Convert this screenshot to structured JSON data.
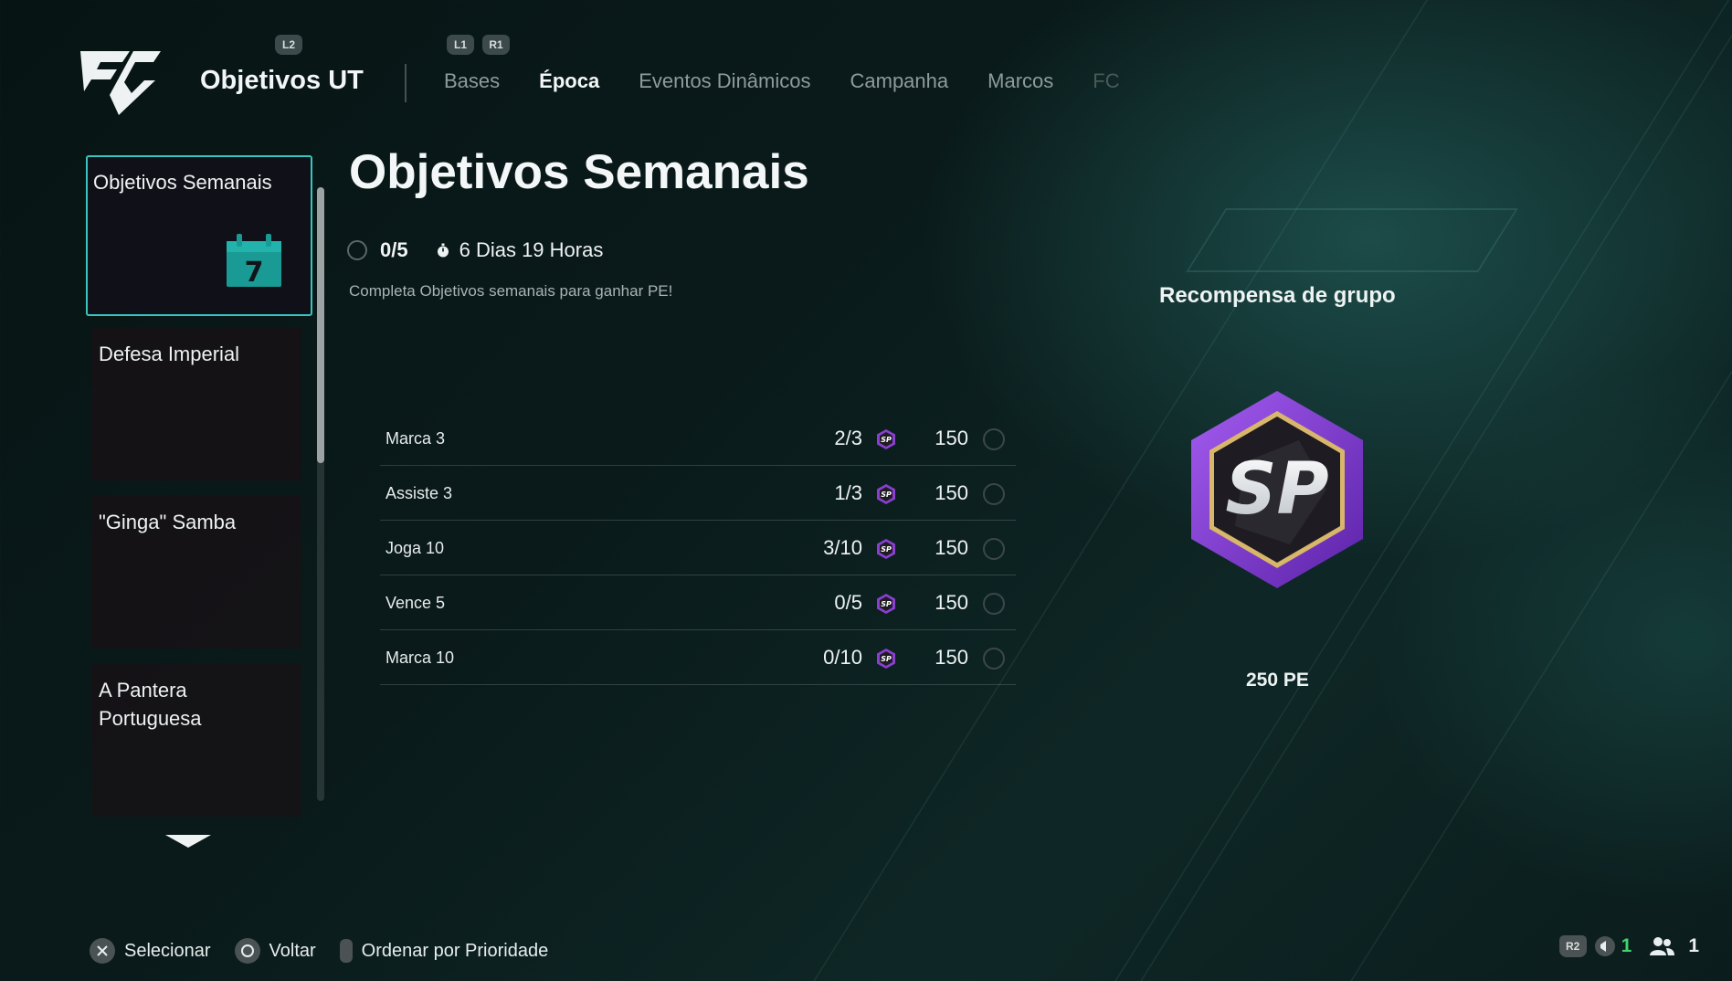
{
  "header": {
    "app_title": "Objetivos UT",
    "hints": {
      "l2": "L2",
      "l1": "L1",
      "r1": "R1"
    },
    "tabs": [
      {
        "label": "Bases",
        "state": "inactive"
      },
      {
        "label": "Época",
        "state": "active"
      },
      {
        "label": "Eventos Dinâmicos",
        "state": "inactive"
      },
      {
        "label": "Campanha",
        "state": "inactive"
      },
      {
        "label": "Marcos",
        "state": "inactive"
      },
      {
        "label": "FC",
        "state": "faded"
      }
    ]
  },
  "sidebar": {
    "items": [
      {
        "label": "Objetivos Semanais",
        "selected": true,
        "icon": "calendar-icon",
        "icon_text": "7"
      },
      {
        "label": "Defesa Imperial",
        "selected": false
      },
      {
        "label": "\"Ginga\" Samba",
        "selected": false
      },
      {
        "label": "A Pantera Portuguesa",
        "selected": false
      }
    ],
    "scroll_position": 0
  },
  "main": {
    "title": "Objetivos Semanais",
    "progress": "0/5",
    "time_remaining": "6 Dias 19 Horas",
    "subtitle": "Completa Objetivos semanais para ganhar PE!",
    "objectives": [
      {
        "name": "Marca 3",
        "progress": "2/3",
        "points": "150",
        "completed": false
      },
      {
        "name": "Assiste 3",
        "progress": "1/3",
        "points": "150",
        "completed": false
      },
      {
        "name": "Joga 10",
        "progress": "3/10",
        "points": "150",
        "completed": false
      },
      {
        "name": "Vence 5",
        "progress": "0/5",
        "points": "150",
        "completed": false
      },
      {
        "name": "Marca 10",
        "progress": "0/10",
        "points": "150",
        "completed": false
      }
    ]
  },
  "reward": {
    "title": "Recompensa de grupo",
    "badge_text": "SP",
    "amount": "250 PE"
  },
  "footer": {
    "select_label": "Selecionar",
    "back_label": "Voltar",
    "sort_label": "Ordenar por Prioridade",
    "r2_label": "R2",
    "count_a": "1",
    "count_b": "1"
  },
  "colors": {
    "accent_teal": "#38c5bf",
    "sp_purple": "#8a3fd1",
    "sp_gold": "#d8b66a",
    "green_count": "#3fd46b"
  }
}
